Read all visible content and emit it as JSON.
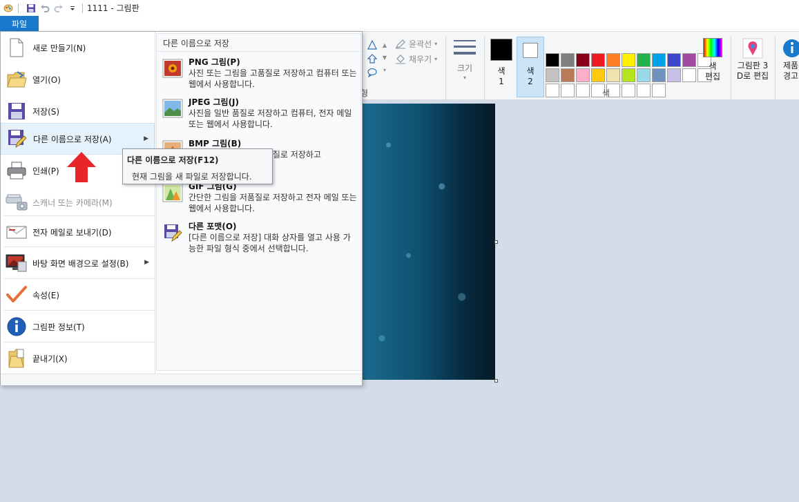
{
  "window": {
    "title": "1111 - 그림판"
  },
  "ribbon": {
    "file_tab": "파일",
    "outline_label": "윤곽선",
    "fill_label": "채우기",
    "shapes_group_label_fragment": "형",
    "size_label": "크기",
    "color1": {
      "line1": "색",
      "line2": "1",
      "color": "#000000"
    },
    "color2": {
      "line1": "색",
      "line2": "2",
      "color": "#ffffff"
    },
    "edit_colors": {
      "line1": "색",
      "line2": "편집"
    },
    "colors_group_label": "색",
    "paint3d": {
      "line1": "그림판 3",
      "line2": "D로 편집"
    },
    "product_alert": {
      "line1": "제품",
      "line2": "경고"
    },
    "palette": [
      "#000000",
      "#7f7f7f",
      "#880015",
      "#ed1c24",
      "#ff7f27",
      "#fff200",
      "#22b14c",
      "#00a2e8",
      "#3f48cc",
      "#a349a4",
      "#ffffff",
      "#c3c3c3",
      "#b97a57",
      "#ffaec9",
      "#ffc90e",
      "#efe4b0",
      "#b5e61d",
      "#99d9ea",
      "#7092be",
      "#c8bfe7",
      "#ffffff",
      "#ffffff",
      "#ffffff",
      "#ffffff",
      "#ffffff",
      "#ffffff",
      "#ffffff",
      "#ffffff",
      "#ffffff",
      "#ffffff"
    ]
  },
  "file_menu": {
    "items": [
      {
        "label": "새로 만들기(N)",
        "icon": "new-file-icon"
      },
      {
        "label": "열기(O)",
        "icon": "open-folder-icon"
      },
      {
        "label": "저장(S)",
        "icon": "save-icon"
      },
      {
        "label": "다른 이름으로 저장(A)",
        "icon": "save-as-icon"
      },
      {
        "label": "인쇄(P)",
        "icon": "printer-icon"
      },
      {
        "label": "스캐너 또는 카메라(M)",
        "icon": "scanner-icon"
      },
      {
        "label": "전자 메일로 보내기(D)",
        "icon": "email-icon"
      },
      {
        "label": "바탕 화면 배경으로 설정(B)",
        "icon": "desktop-background-icon"
      },
      {
        "label": "속성(E)",
        "icon": "checkmark-icon"
      },
      {
        "label": "그림판 정보(T)",
        "icon": "info-icon"
      },
      {
        "label": "끝내기(X)",
        "icon": "exit-icon"
      }
    ],
    "submenu": {
      "header": "다른 이름으로 저장",
      "items": [
        {
          "title": "PNG 그림(P)",
          "desc": "사진 또는 그림을 고품질로 저장하고 컴퓨터 또는 웹에서 사용합니다."
        },
        {
          "title": "JPEG 그림(J)",
          "desc": "사진을 일반 품질로 저장하고 컴퓨터, 전자 메일 또는 웹에서 사용합니다."
        },
        {
          "title": "BMP 그림(B)",
          "desc": "모든 종류의 그림을 고품질로 저장하고"
        },
        {
          "title": "GIF 그림(G)",
          "desc": "간단한 그림을 저품질로 저장하고 전자 메일 또는 웹에서 사용합니다."
        },
        {
          "title": "다른 포맷(O)",
          "desc": "[다른 이름으로 저장] 대화 상자를 열고 사용 가능한 파일 형식 중에서 선택합니다."
        }
      ]
    }
  },
  "tooltip": {
    "title": "다른 이름으로 저장(F12)",
    "desc": "현재 그림을 새 파일로 저장합니다."
  }
}
